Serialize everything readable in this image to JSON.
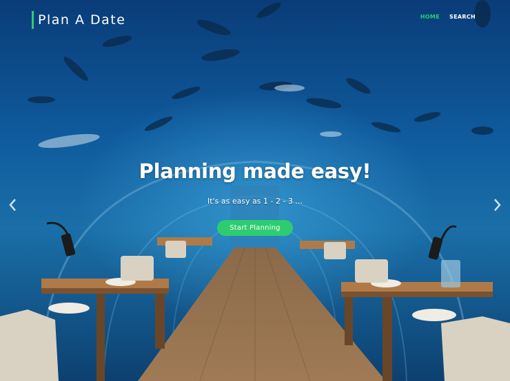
{
  "brand": {
    "name": "Plan A Date",
    "accent_color": "#2ecc71"
  },
  "nav": {
    "items": [
      {
        "label": "HOME",
        "active": true
      },
      {
        "label": "SEARCH",
        "active": false
      }
    ]
  },
  "hero": {
    "headline": "Planning made easy!",
    "subtext": "It's as easy as 1 - 2 - 3 ...",
    "cta_label": "Start Planning",
    "background": "underwater restaurant tunnel photo",
    "prev_icon": "chevron-left-icon",
    "next_icon": "chevron-right-icon"
  },
  "colors": {
    "accent": "#2ecc71",
    "text": "#ffffff",
    "water": "#0d4d86"
  }
}
